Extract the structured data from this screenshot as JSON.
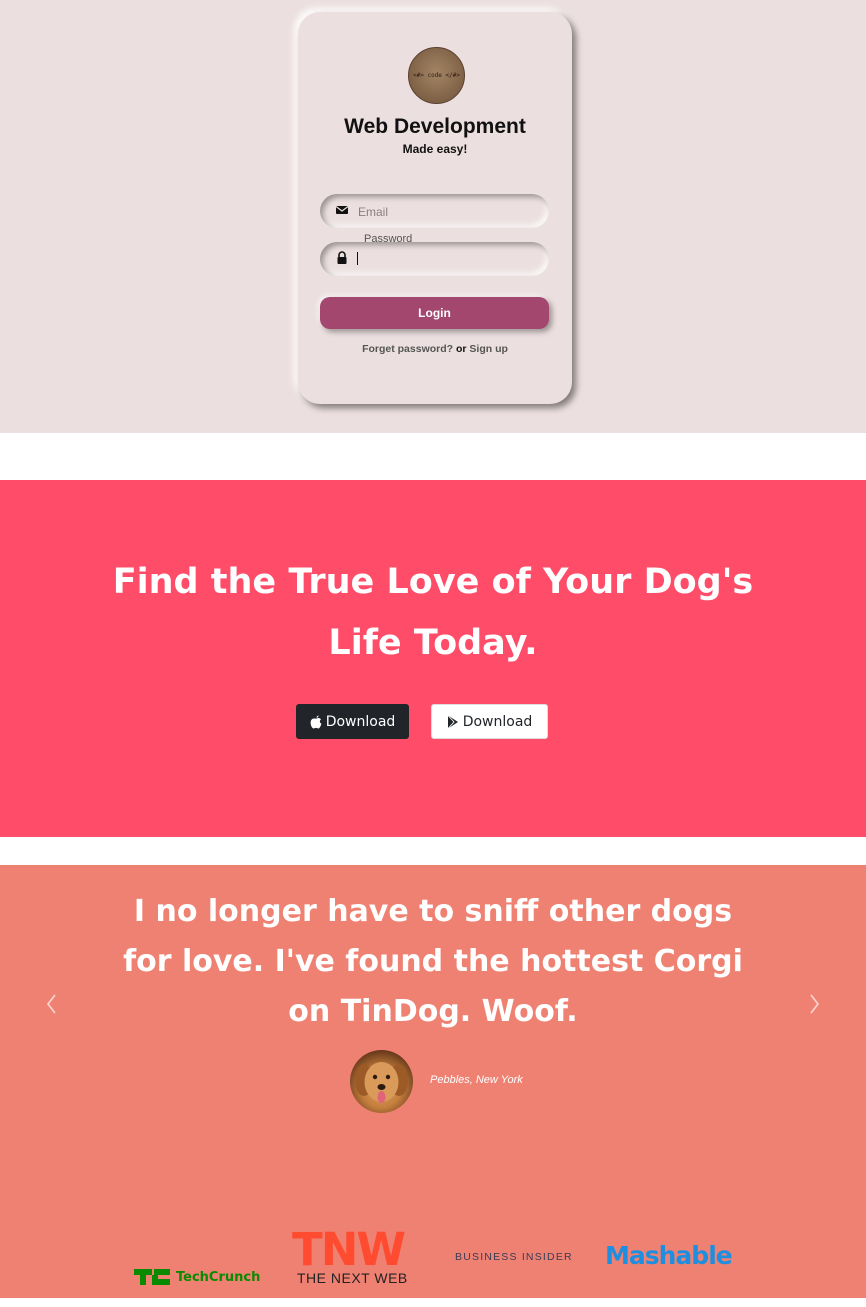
{
  "login": {
    "logo_text": "<#> code </#>",
    "title": "Web Development",
    "subtitle": "Made easy!",
    "email_placeholder": "Email",
    "password_label": "Password",
    "password_value": "",
    "login_button": "Login",
    "forgot_link": "Forget password?",
    "or_text": "or",
    "signup_link": "Sign up"
  },
  "cta": {
    "title": "Find the True Love of Your Dog's Life Today.",
    "apple_button": "Download",
    "play_button": "Download"
  },
  "testimonial": {
    "quote": "I no longer have to sniff other dogs for love. I've found the hottest Corgi on TinDog. Woof.",
    "caption": "Pebbles, New York"
  },
  "press": {
    "techcrunch": "TechCrunch",
    "tnw_big": "TNW",
    "tnw_small": "THE NEXT WEB",
    "business_insider": "BUSINESS INSIDER",
    "mashable": "Mashable"
  },
  "colors": {
    "login_bg": "#ecdfdf",
    "login_button": "#a3476e",
    "cta_bg": "#ff4c68",
    "testimonial_bg": "#ef8172"
  },
  "icons": [
    "envelope-icon",
    "lock-icon",
    "apple-icon",
    "play-store-icon",
    "chevron-left-icon",
    "chevron-right-icon"
  ]
}
